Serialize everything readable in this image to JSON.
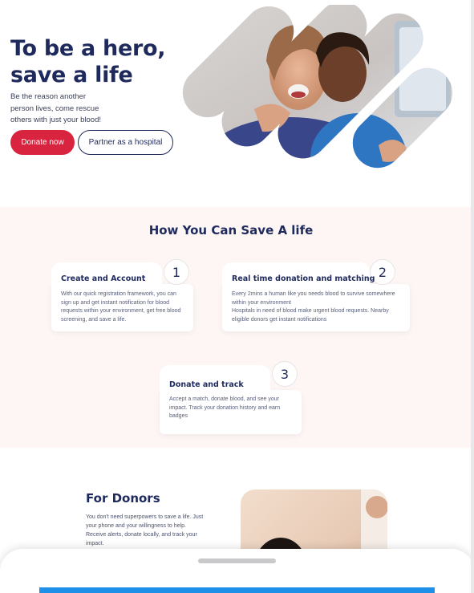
{
  "hero": {
    "title_line1": "To be a hero,",
    "title_line2": "save a life",
    "subtitle_line1": "Be the reason another",
    "subtitle_line2": "person lives, come  rescue",
    "subtitle_line3": "others with just your blood!",
    "donate_label": "Donate now",
    "partner_label": "Partner as a  hospital"
  },
  "how": {
    "title": "How You Can Save A life",
    "steps": [
      {
        "number": "1",
        "title": "Create and Account",
        "description": "With our quick registration framework, you can sign up and get instant notification for blood requests within your environment, get free blood screening, and save a life."
      },
      {
        "number": "2",
        "title": "Real time donation and matching",
        "description_line1": "Every 2mins a human like you needs blood to survive somewhere within your environment",
        "description_line2": "Hospitals in need of blood make urgent blood requests. Nearby eligible donors get instant notifications"
      },
      {
        "number": "3",
        "title": "Donate and track",
        "description": "Accept a match, donate blood, and see your impact. Track your donation history and earn badges"
      }
    ]
  },
  "donors": {
    "title": "For Donors",
    "description_line1": "You don't need superpowers to save a life. Just your phone and your willingness to help.",
    "description_line2": "Receive alerts, donate locally, and track your impact."
  },
  "colors": {
    "primary_red": "#d9243f",
    "navy": "#1f2a5c",
    "section_bg": "#fdf6f4",
    "sheet_accent": "#1e90e8"
  }
}
